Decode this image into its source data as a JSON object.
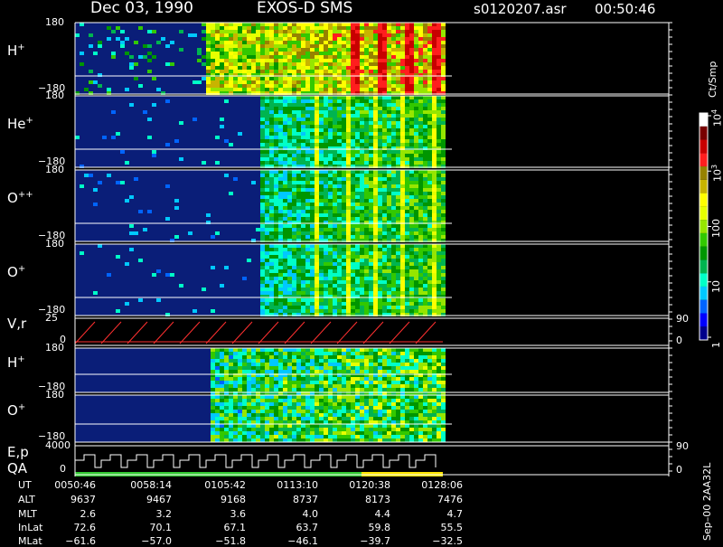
{
  "header": {
    "date": "Dec 03, 1990",
    "instrument": "EXOS-D SMS",
    "file": "s0120207.asr",
    "time": "00:50:46"
  },
  "colorbar": {
    "unit": "Ct/Smp",
    "ticks": [
      "1",
      "10",
      "100",
      "10",
      "10"
    ],
    "tick_exponents": [
      "",
      "",
      "",
      "3",
      "4"
    ],
    "tick_values": [
      1,
      10,
      100,
      1000,
      10000
    ],
    "colors": [
      "#00008b",
      "#0000ff",
      "#0064ff",
      "#00c8ff",
      "#00ffc8",
      "#00b450",
      "#009600",
      "#32c800",
      "#96e600",
      "#e6ff00",
      "#ffff00",
      "#c8b400",
      "#968200",
      "#ff1e1e",
      "#c80000",
      "#780000",
      "#ffffff"
    ]
  },
  "panels": [
    {
      "id": "h-plus-spectrogram",
      "label": "H",
      "sup": "+",
      "ymax": "180",
      "ymin": "−180"
    },
    {
      "id": "he-plus-spectrogram",
      "label": "He",
      "sup": "+",
      "ymax": "180",
      "ymin": "−180"
    },
    {
      "id": "o-plus-plus-spectrogram",
      "label": "O",
      "sup": "++",
      "ymax": "180",
      "ymin": "−180"
    },
    {
      "id": "o-plus-spectrogram",
      "label": "O",
      "sup": "+",
      "ymax": "180",
      "ymin": "−180"
    },
    {
      "id": "vr-panel",
      "label": "V,r",
      "sup": "",
      "ymax": "25",
      "ymin": "0",
      "right_top": "90",
      "right_bottom": "0"
    },
    {
      "id": "h-plus-spectrogram-2",
      "label": "H",
      "sup": "+",
      "ymax": "180",
      "ymin": "−180"
    },
    {
      "id": "o-plus-spectrogram-2",
      "label": "O",
      "sup": "+",
      "ymax": "180",
      "ymin": "−180"
    },
    {
      "id": "ep-qa-panel",
      "label": "E,p",
      "label2": "QA",
      "sup": "",
      "ymax": "4000",
      "ymin": "0",
      "right_top": "90",
      "right_bottom": "0"
    }
  ],
  "side_label": "Sep–00  2AA32L",
  "ephemeris": {
    "row_labels": [
      "UT",
      "ALT",
      "MLT",
      "InLat",
      "MLat"
    ],
    "columns": [
      [
        "0050:46",
        "9637",
        "2.6",
        "72.6",
        "−61.6"
      ],
      [
        "0058:14",
        "9467",
        "3.2",
        "70.1",
        "−57.0"
      ],
      [
        "0105:42",
        "9168",
        "3.6",
        "67.1",
        "−51.8"
      ],
      [
        "0113:10",
        "8737",
        "4.0",
        "63.7",
        "−46.1"
      ],
      [
        "0120:38",
        "8173",
        "4.4",
        "59.8",
        "−39.7"
      ],
      [
        "0128:06",
        "7476",
        "4.7",
        "55.5",
        "−32.5"
      ]
    ]
  },
  "chart_data": {
    "type": "heatmap",
    "title": "Dec 03, 1990  EXOS-D SMS",
    "x": [
      "0050:46",
      "0058:14",
      "0105:42",
      "0113:10",
      "0120:38",
      "0128:06"
    ],
    "data_end": "0128:06",
    "z_unit": "Ct/Smp",
    "z_scale": "log",
    "z_range": [
      1,
      10000
    ],
    "panels": [
      {
        "name": "H+",
        "ylim": [
          -180,
          180
        ]
      },
      {
        "name": "He+",
        "ylim": [
          -180,
          180
        ]
      },
      {
        "name": "O++",
        "ylim": [
          -180,
          180
        ]
      },
      {
        "name": "O+",
        "ylim": [
          -180,
          180
        ]
      },
      {
        "name": "V,r",
        "ylim": [
          0,
          25
        ]
      },
      {
        "name": "H+",
        "ylim": [
          -180,
          180
        ]
      },
      {
        "name": "O+",
        "ylim": [
          -180,
          180
        ]
      },
      {
        "name": "E,p",
        "ylim": [
          0,
          4000
        ]
      }
    ]
  }
}
